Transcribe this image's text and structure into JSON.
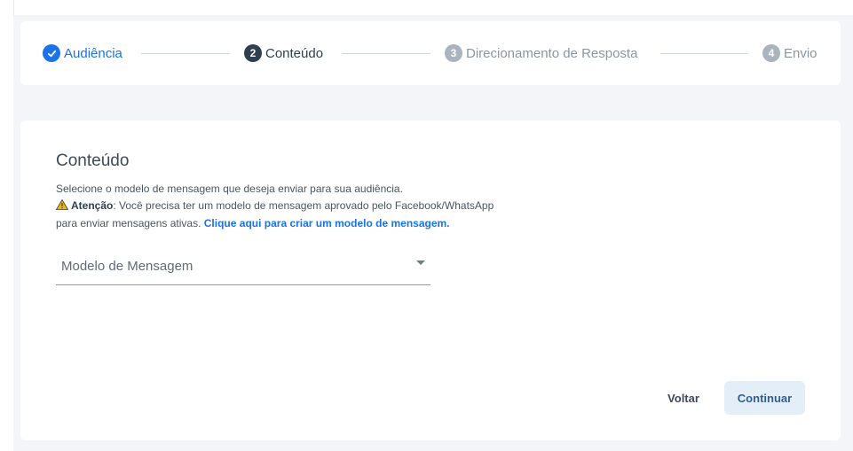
{
  "stepper": {
    "steps": [
      {
        "number": "1",
        "label": "Audiência",
        "state": "completed"
      },
      {
        "number": "2",
        "label": "Conteúdo",
        "state": "active"
      },
      {
        "number": "3",
        "label": "Direcionamento de Resposta",
        "state": "pending"
      },
      {
        "number": "4",
        "label": "Envio",
        "state": "pending"
      }
    ]
  },
  "content": {
    "title": "Conteúdo",
    "description": "Selecione o modelo de mensagem que deseja enviar para sua audiência.",
    "warning_label": "Atenção",
    "warning_text": ": Você precisa ter um modelo de mensagem aprovado pelo Facebook/WhatsApp",
    "warning_text_2": "para enviar mensagens ativas. ",
    "link_text": "Clique aqui para criar um modelo de mensagem."
  },
  "select": {
    "placeholder": "Modelo de Mensagem"
  },
  "actions": {
    "back_label": "Voltar",
    "next_label": "Continuar"
  },
  "colors": {
    "accent": "#1a73e8",
    "active_step": "#2f3f52",
    "pending_step": "#aab4be",
    "warning": "#f2b705",
    "next_button_bg": "#e3eef9"
  }
}
